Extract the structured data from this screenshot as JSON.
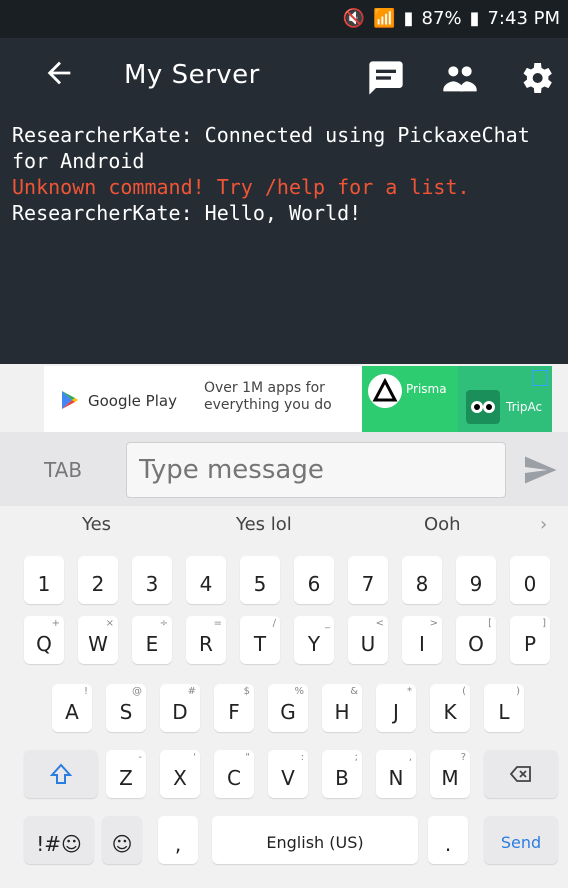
{
  "status_bar": {
    "battery": "87%",
    "time": "7:43 PM"
  },
  "app_bar": {
    "title": "My Server"
  },
  "chat": {
    "messages": [
      {
        "text": "ResearcherKate: Connected using PickaxeChat for Android",
        "type": "normal"
      },
      {
        "text": "Unknown command! Try /help for a list.",
        "type": "error"
      },
      {
        "text": "ResearcherKate: Hello, World!",
        "type": "normal"
      }
    ]
  },
  "ad": {
    "store": "Google Play",
    "copy_line1": "Over 1M apps for",
    "copy_line2": "everything you do",
    "app1": "Prisma",
    "app2": "TripAc"
  },
  "input": {
    "tab_label": "TAB",
    "placeholder": "Type message"
  },
  "suggestions": [
    "Yes",
    "Yes lol",
    "Ooh"
  ],
  "keyboard": {
    "row_numbers": [
      "1",
      "2",
      "3",
      "4",
      "5",
      "6",
      "7",
      "8",
      "9",
      "0"
    ],
    "row1": [
      {
        "main": "Q",
        "sub": "+"
      },
      {
        "main": "W",
        "sub": "×"
      },
      {
        "main": "E",
        "sub": "÷"
      },
      {
        "main": "R",
        "sub": "="
      },
      {
        "main": "T",
        "sub": "/"
      },
      {
        "main": "Y",
        "sub": "_"
      },
      {
        "main": "U",
        "sub": "<"
      },
      {
        "main": "I",
        "sub": ">"
      },
      {
        "main": "O",
        "sub": "["
      },
      {
        "main": "P",
        "sub": "]"
      }
    ],
    "row2": [
      {
        "main": "A",
        "sub": "!"
      },
      {
        "main": "S",
        "sub": "@"
      },
      {
        "main": "D",
        "sub": "#"
      },
      {
        "main": "F",
        "sub": "$"
      },
      {
        "main": "G",
        "sub": "%"
      },
      {
        "main": "H",
        "sub": "&"
      },
      {
        "main": "J",
        "sub": "*"
      },
      {
        "main": "K",
        "sub": "("
      },
      {
        "main": "L",
        "sub": ")"
      }
    ],
    "row3": [
      {
        "main": "Z",
        "sub": "-"
      },
      {
        "main": "X",
        "sub": "'"
      },
      {
        "main": "C",
        "sub": "\""
      },
      {
        "main": "V",
        "sub": ":"
      },
      {
        "main": "B",
        "sub": ";"
      },
      {
        "main": "N",
        "sub": ","
      },
      {
        "main": "M",
        "sub": "?"
      }
    ],
    "symbols_label": "!#☺",
    "emoji_label": "☺",
    "comma_label": ",",
    "space_label": "English (US)",
    "period_label": ".",
    "send_label": "Send"
  }
}
